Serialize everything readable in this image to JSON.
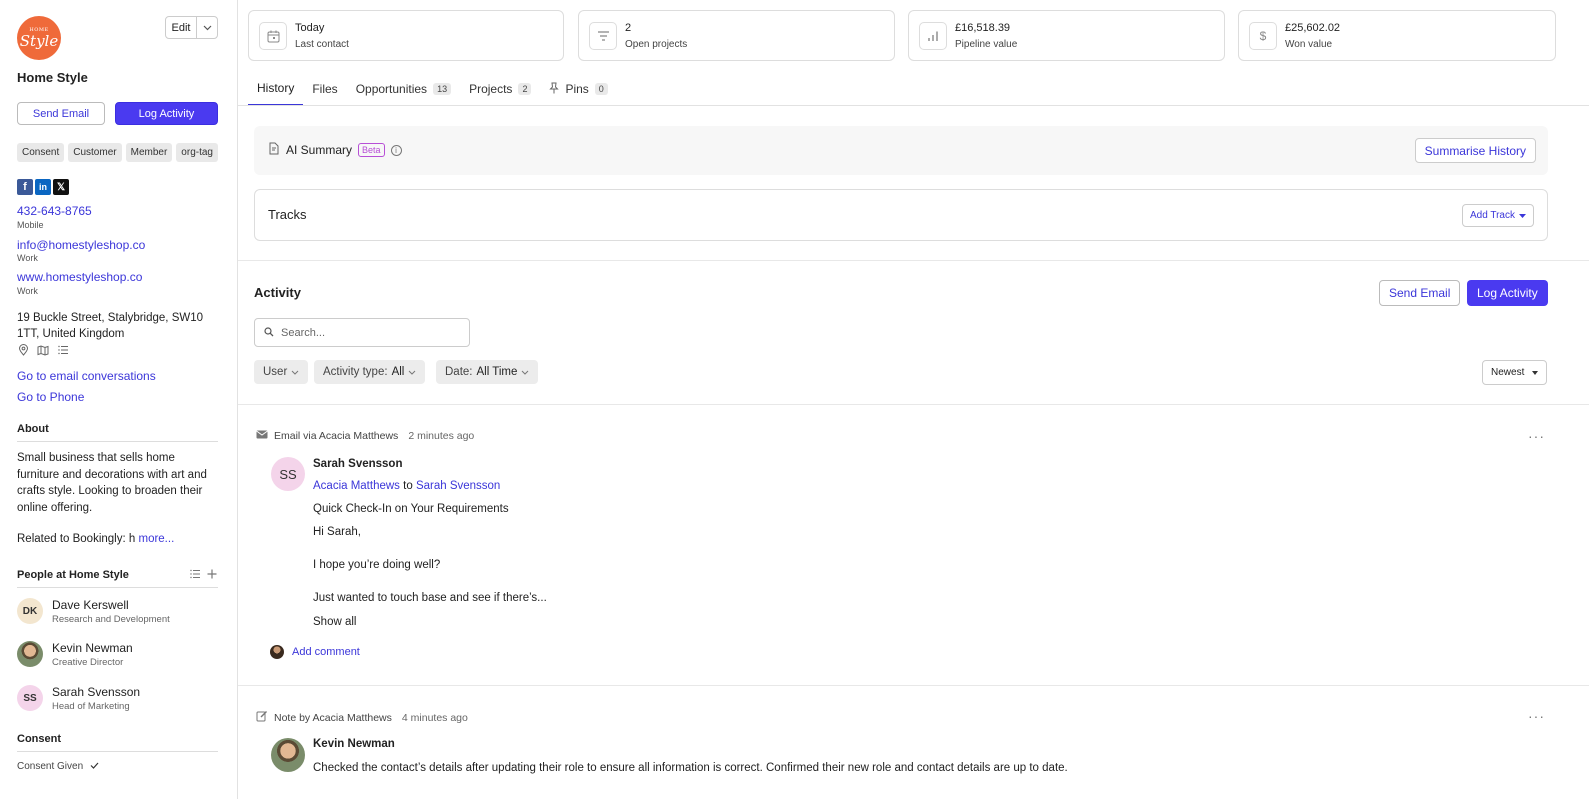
{
  "company": {
    "logo_small": "HOME",
    "logo_big": "Style",
    "name": "Home Style",
    "edit_label": "Edit",
    "send_email": "Send Email",
    "log_activity": "Log Activity",
    "tags": [
      "Consent",
      "Customer",
      "Member",
      "org-tag"
    ],
    "phone": "432-643-8765",
    "phone_type": "Mobile",
    "email": "info@homestyleshop.co",
    "email_type": "Work",
    "website": "www.homestyleshop.co",
    "website_type": "Work",
    "address": "19 Buckle Street, Stalybridge, SW10 1TT, United Kingdom",
    "goto_email": "Go to email conversations",
    "goto_phone": "Go to Phone",
    "about_title": "About",
    "about_text": "Small business that sells home furniture and decorations with art and crafts style. Looking to broaden their online offering.",
    "related_prefix": "Related to Bookingly: h",
    "related_more": "more...",
    "people_title": "People at Home Style",
    "people": [
      {
        "initials": "DK",
        "name": "Dave Kerswell",
        "role": "Research and Development"
      },
      {
        "initials": "",
        "name": "Kevin Newman",
        "role": "Creative Director"
      },
      {
        "initials": "SS",
        "name": "Sarah Svensson",
        "role": "Head of Marketing"
      }
    ],
    "consent_title": "Consent",
    "consent_given": "Consent Given"
  },
  "stats": [
    {
      "value": "Today",
      "label": "Last contact",
      "icon": "calendar-icon"
    },
    {
      "value": "2",
      "label": "Open projects",
      "icon": "projects-icon"
    },
    {
      "value": "£16,518.39",
      "label": "Pipeline value",
      "icon": "bar-chart-icon"
    },
    {
      "value": "£25,602.02",
      "label": "Won value",
      "icon": "dollar-icon"
    }
  ],
  "tabs": [
    {
      "label": "History",
      "count": null
    },
    {
      "label": "Files",
      "count": null
    },
    {
      "label": "Opportunities",
      "count": "13"
    },
    {
      "label": "Projects",
      "count": "2"
    },
    {
      "label": "Pins",
      "count": "0"
    }
  ],
  "ai": {
    "label": "AI Summary",
    "badge": "Beta",
    "button": "Summarise History"
  },
  "tracks": {
    "title": "Tracks",
    "button": "Add Track"
  },
  "activity": {
    "title": "Activity",
    "send_email": "Send Email",
    "log_activity": "Log Activity",
    "search_placeholder": "Search...",
    "filter_user": "User",
    "filter_type_label": "Activity type:",
    "filter_type_value": "All",
    "filter_date_label": "Date:",
    "filter_date_value": "All Time",
    "sort": "Newest"
  },
  "entries": [
    {
      "kind": "Email via Acacia Matthews",
      "time": "2 minutes ago",
      "avatar": "SS",
      "name": "Sarah Svensson",
      "from": "Acacia Matthews",
      "to_word": "to",
      "to": "Sarah Svensson",
      "subject": "Quick Check-In on Your Requirements",
      "line1": "Hi Sarah,",
      "line2": "I hope you’re doing well?",
      "line3": "Just wanted to touch base and see if there’s...",
      "show_all": "Show all",
      "add_comment": "Add comment"
    },
    {
      "kind": "Note by Acacia Matthews",
      "time": "4 minutes ago",
      "name": "Kevin Newman",
      "body": "Checked the contact’s details after updating their role to ensure all information is correct. Confirmed their new role and contact details are up to date."
    }
  ]
}
